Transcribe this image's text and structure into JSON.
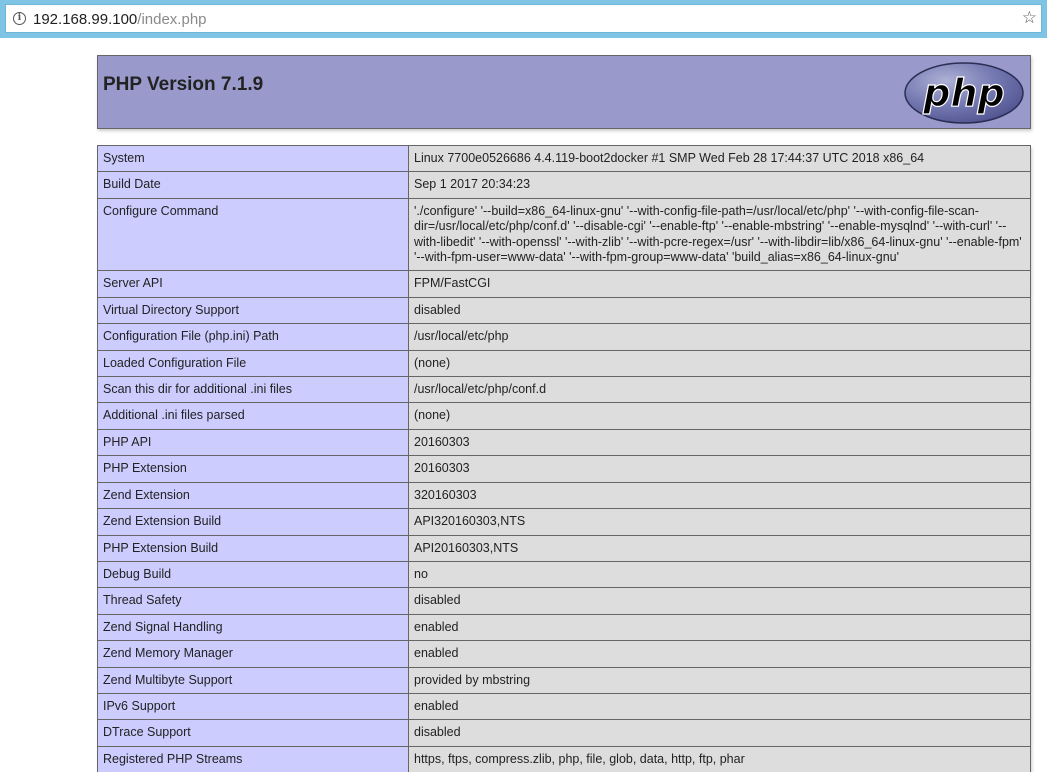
{
  "browser": {
    "url_host": "192.168.99.100",
    "url_path": "/index.php",
    "info_icon": "info-icon",
    "bookmark_icon": "star-icon"
  },
  "header": {
    "title": "PHP Version 7.1.9",
    "logo_text": "php",
    "colors": {
      "header_bg": "#9999cc",
      "label_bg": "#ccccff",
      "value_bg": "#dddddd"
    }
  },
  "rows": [
    {
      "label": "System",
      "value": "Linux 7700e0526686 4.4.119-boot2docker #1 SMP Wed Feb 28 17:44:37 UTC 2018 x86_64"
    },
    {
      "label": "Build Date",
      "value": "Sep 1 2017 20:34:23"
    },
    {
      "label": "Configure Command",
      "value": "'./configure' '--build=x86_64-linux-gnu' '--with-config-file-path=/usr/local/etc/php' '--with-config-file-scan-dir=/usr/local/etc/php/conf.d' '--disable-cgi' '--enable-ftp' '--enable-mbstring' '--enable-mysqlnd' '--with-curl' '--with-libedit' '--with-openssl' '--with-zlib' '--with-pcre-regex=/usr' '--with-libdir=lib/x86_64-linux-gnu' '--enable-fpm' '--with-fpm-user=www-data' '--with-fpm-group=www-data' 'build_alias=x86_64-linux-gnu'"
    },
    {
      "label": "Server API",
      "value": "FPM/FastCGI"
    },
    {
      "label": "Virtual Directory Support",
      "value": "disabled"
    },
    {
      "label": "Configuration File (php.ini) Path",
      "value": "/usr/local/etc/php"
    },
    {
      "label": "Loaded Configuration File",
      "value": "(none)"
    },
    {
      "label": "Scan this dir for additional .ini files",
      "value": "/usr/local/etc/php/conf.d"
    },
    {
      "label": "Additional .ini files parsed",
      "value": "(none)"
    },
    {
      "label": "PHP API",
      "value": "20160303"
    },
    {
      "label": "PHP Extension",
      "value": "20160303"
    },
    {
      "label": "Zend Extension",
      "value": "320160303"
    },
    {
      "label": "Zend Extension Build",
      "value": "API320160303,NTS"
    },
    {
      "label": "PHP Extension Build",
      "value": "API20160303,NTS"
    },
    {
      "label": "Debug Build",
      "value": "no"
    },
    {
      "label": "Thread Safety",
      "value": "disabled"
    },
    {
      "label": "Zend Signal Handling",
      "value": "enabled"
    },
    {
      "label": "Zend Memory Manager",
      "value": "enabled"
    },
    {
      "label": "Zend Multibyte Support",
      "value": "provided by mbstring"
    },
    {
      "label": "IPv6 Support",
      "value": "enabled"
    },
    {
      "label": "DTrace Support",
      "value": "disabled"
    },
    {
      "label": "Registered PHP Streams",
      "value": "https, ftps, compress.zlib, php, file, glob, data, http, ftp, phar"
    }
  ]
}
